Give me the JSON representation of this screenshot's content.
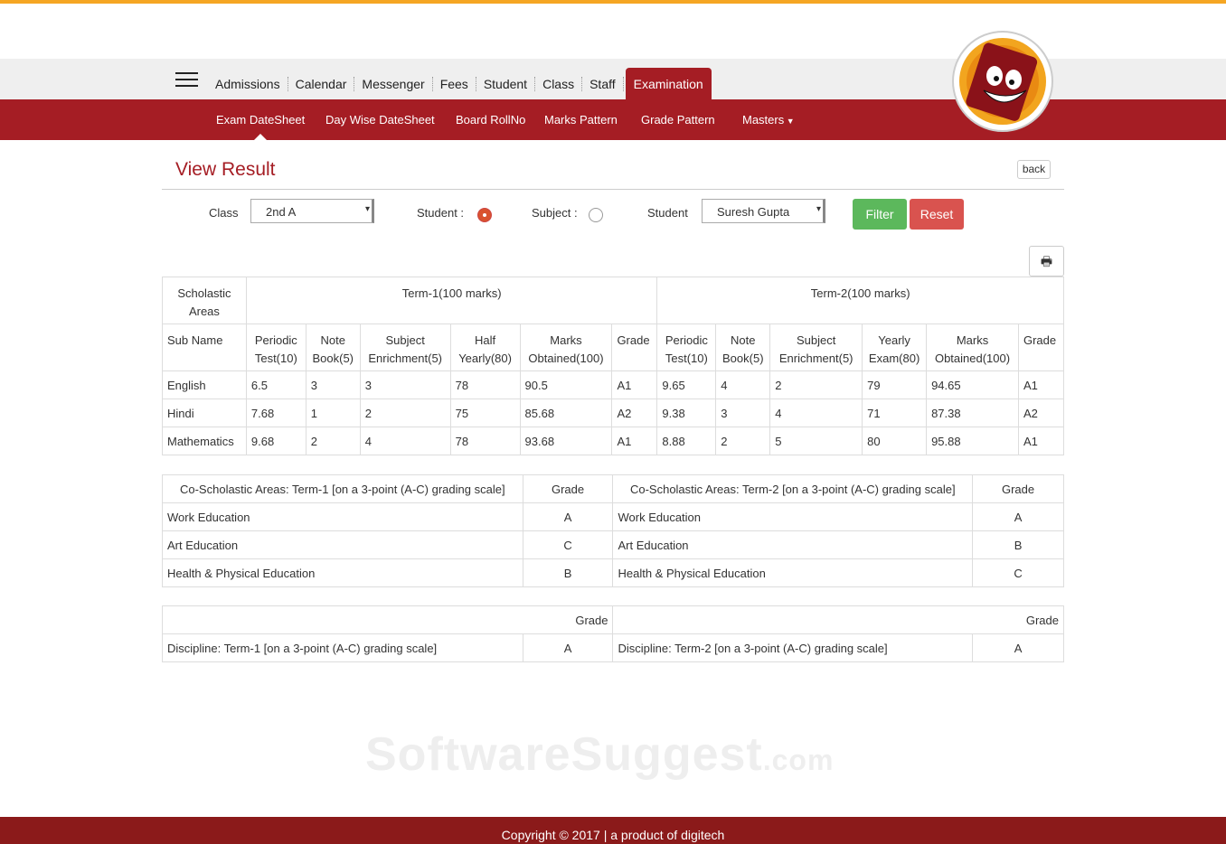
{
  "nav": {
    "items": [
      "Admissions",
      "Calendar",
      "Messenger",
      "Fees",
      "Student",
      "Class",
      "Staff",
      "Examination"
    ],
    "active": "Examination"
  },
  "subnav": {
    "items": [
      "Exam DateSheet",
      "Day Wise DateSheet",
      "Board RollNo",
      "Marks Pattern",
      "Grade Pattern",
      "Masters"
    ]
  },
  "page": {
    "title": "View Result",
    "back": "back"
  },
  "filters": {
    "class_label": "Class",
    "class_value": "2nd A",
    "student_radio": "Student :",
    "subject_radio": "Subject :",
    "student_label": "Student",
    "student_value": "Suresh Gupta",
    "filter": "Filter",
    "reset": "Reset"
  },
  "scholastic": {
    "head1": [
      "Scholastic Areas",
      "Term-1(100 marks)",
      "Term-2(100 marks)"
    ],
    "head2": [
      "Sub Name",
      "Periodic Test(10)",
      "Note Book(5)",
      "Subject Enrichment(5)",
      "Half Yearly(80)",
      "Marks Obtained(100)",
      "Grade",
      "Periodic Test(10)",
      "Note Book(5)",
      "Subject Enrichment(5)",
      "Yearly Exam(80)",
      "Marks Obtained(100)",
      "Grade"
    ],
    "rows": [
      [
        "English",
        "6.5",
        "3",
        "3",
        "78",
        "90.5",
        "A1",
        "9.65",
        "4",
        "2",
        "79",
        "94.65",
        "A1"
      ],
      [
        "Hindi",
        "7.68",
        "1",
        "2",
        "75",
        "85.68",
        "A2",
        "9.38",
        "3",
        "4",
        "71",
        "87.38",
        "A2"
      ],
      [
        "Mathematics",
        "9.68",
        "2",
        "4",
        "78",
        "93.68",
        "A1",
        "8.88",
        "2",
        "5",
        "80",
        "95.88",
        "A1"
      ]
    ]
  },
  "coscholastic": {
    "head": [
      "Co-Scholastic Areas: Term-1 [on a 3-point (A-C) grading scale]",
      "Grade",
      "Co-Scholastic Areas: Term-2 [on a 3-point (A-C) grading scale]",
      "Grade"
    ],
    "rows": [
      [
        "Work Education",
        "A",
        "Work Education",
        "A"
      ],
      [
        "Art Education",
        "C",
        "Art Education",
        "B"
      ],
      [
        "Health & Physical Education",
        "B",
        "Health & Physical Education",
        "C"
      ]
    ]
  },
  "discipline": {
    "head": [
      "Grade",
      "Grade"
    ],
    "row": [
      "Discipline: Term-1 [on a 3-point (A-C) grading scale]",
      "A",
      "Discipline: Term-2 [on a 3-point (A-C) grading scale]",
      "A"
    ]
  },
  "watermark": {
    "main": "SoftwareSuggest",
    "suffix": ".com"
  },
  "footer": "Copyright © 2017 | a product of digitech"
}
